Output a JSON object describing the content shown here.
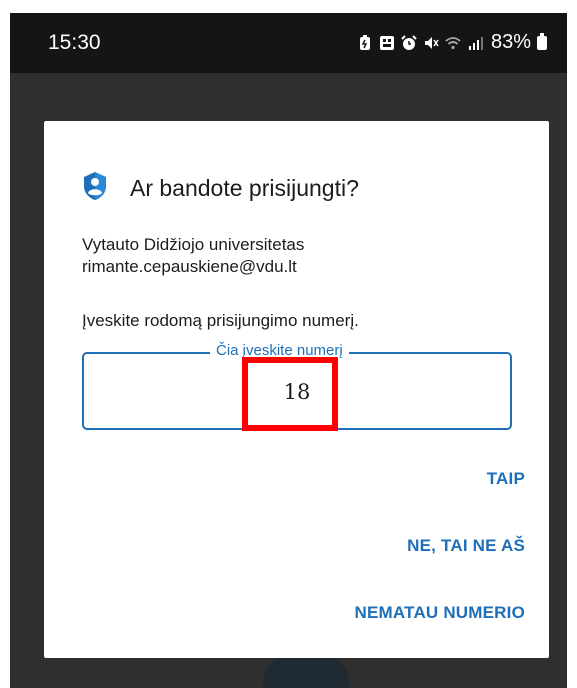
{
  "status_bar": {
    "time": "15:30",
    "battery": "83%",
    "icons": [
      "battery-saver-icon",
      "sim-icon",
      "alarm-icon",
      "mute-icon",
      "wifi-icon",
      "signal-icon"
    ]
  },
  "dialog": {
    "title": "Ar bandote prisijungti?",
    "organization": "Vytauto Didžiojo universitetas",
    "email": "rimante.cepauskiene@vdu.lt",
    "instruction": "Įveskite rodomą prisijungimo numerį.",
    "input_label": "Čia įveskite numerį",
    "input_value": "18",
    "actions": {
      "yes": "TAIP",
      "no": "NE, TAI NE AŠ",
      "cant_see": "NEMATAU NUMERIO"
    }
  },
  "colors": {
    "accent": "#1e6fb8",
    "highlight": "#ff0000",
    "overlay": "#2f2f2f"
  }
}
